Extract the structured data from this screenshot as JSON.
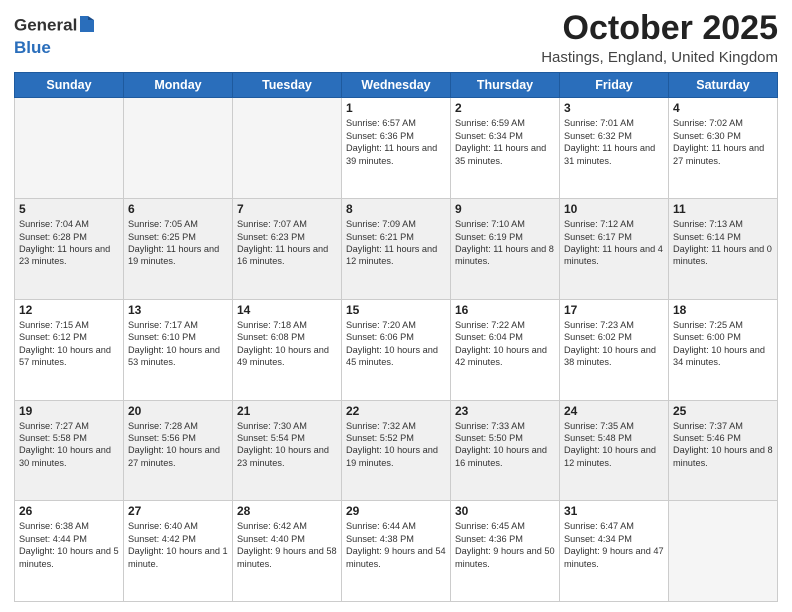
{
  "header": {
    "logo_general": "General",
    "logo_blue": "Blue",
    "title": "October 2025",
    "location": "Hastings, England, United Kingdom"
  },
  "days_of_week": [
    "Sunday",
    "Monday",
    "Tuesday",
    "Wednesday",
    "Thursday",
    "Friday",
    "Saturday"
  ],
  "weeks": [
    [
      {
        "day": "",
        "empty": true
      },
      {
        "day": "",
        "empty": true
      },
      {
        "day": "",
        "empty": true
      },
      {
        "day": "1",
        "sunrise": "6:57 AM",
        "sunset": "6:36 PM",
        "daylight": "11 hours and 39 minutes."
      },
      {
        "day": "2",
        "sunrise": "6:59 AM",
        "sunset": "6:34 PM",
        "daylight": "11 hours and 35 minutes."
      },
      {
        "day": "3",
        "sunrise": "7:01 AM",
        "sunset": "6:32 PM",
        "daylight": "11 hours and 31 minutes."
      },
      {
        "day": "4",
        "sunrise": "7:02 AM",
        "sunset": "6:30 PM",
        "daylight": "11 hours and 27 minutes."
      }
    ],
    [
      {
        "day": "5",
        "sunrise": "7:04 AM",
        "sunset": "6:28 PM",
        "daylight": "11 hours and 23 minutes."
      },
      {
        "day": "6",
        "sunrise": "7:05 AM",
        "sunset": "6:25 PM",
        "daylight": "11 hours and 19 minutes."
      },
      {
        "day": "7",
        "sunrise": "7:07 AM",
        "sunset": "6:23 PM",
        "daylight": "11 hours and 16 minutes."
      },
      {
        "day": "8",
        "sunrise": "7:09 AM",
        "sunset": "6:21 PM",
        "daylight": "11 hours and 12 minutes."
      },
      {
        "day": "9",
        "sunrise": "7:10 AM",
        "sunset": "6:19 PM",
        "daylight": "11 hours and 8 minutes."
      },
      {
        "day": "10",
        "sunrise": "7:12 AM",
        "sunset": "6:17 PM",
        "daylight": "11 hours and 4 minutes."
      },
      {
        "day": "11",
        "sunrise": "7:13 AM",
        "sunset": "6:14 PM",
        "daylight": "11 hours and 0 minutes."
      }
    ],
    [
      {
        "day": "12",
        "sunrise": "7:15 AM",
        "sunset": "6:12 PM",
        "daylight": "10 hours and 57 minutes."
      },
      {
        "day": "13",
        "sunrise": "7:17 AM",
        "sunset": "6:10 PM",
        "daylight": "10 hours and 53 minutes."
      },
      {
        "day": "14",
        "sunrise": "7:18 AM",
        "sunset": "6:08 PM",
        "daylight": "10 hours and 49 minutes."
      },
      {
        "day": "15",
        "sunrise": "7:20 AM",
        "sunset": "6:06 PM",
        "daylight": "10 hours and 45 minutes."
      },
      {
        "day": "16",
        "sunrise": "7:22 AM",
        "sunset": "6:04 PM",
        "daylight": "10 hours and 42 minutes."
      },
      {
        "day": "17",
        "sunrise": "7:23 AM",
        "sunset": "6:02 PM",
        "daylight": "10 hours and 38 minutes."
      },
      {
        "day": "18",
        "sunrise": "7:25 AM",
        "sunset": "6:00 PM",
        "daylight": "10 hours and 34 minutes."
      }
    ],
    [
      {
        "day": "19",
        "sunrise": "7:27 AM",
        "sunset": "5:58 PM",
        "daylight": "10 hours and 30 minutes."
      },
      {
        "day": "20",
        "sunrise": "7:28 AM",
        "sunset": "5:56 PM",
        "daylight": "10 hours and 27 minutes."
      },
      {
        "day": "21",
        "sunrise": "7:30 AM",
        "sunset": "5:54 PM",
        "daylight": "10 hours and 23 minutes."
      },
      {
        "day": "22",
        "sunrise": "7:32 AM",
        "sunset": "5:52 PM",
        "daylight": "10 hours and 19 minutes."
      },
      {
        "day": "23",
        "sunrise": "7:33 AM",
        "sunset": "5:50 PM",
        "daylight": "10 hours and 16 minutes."
      },
      {
        "day": "24",
        "sunrise": "7:35 AM",
        "sunset": "5:48 PM",
        "daylight": "10 hours and 12 minutes."
      },
      {
        "day": "25",
        "sunrise": "7:37 AM",
        "sunset": "5:46 PM",
        "daylight": "10 hours and 8 minutes."
      }
    ],
    [
      {
        "day": "26",
        "sunrise": "6:38 AM",
        "sunset": "4:44 PM",
        "daylight": "10 hours and 5 minutes."
      },
      {
        "day": "27",
        "sunrise": "6:40 AM",
        "sunset": "4:42 PM",
        "daylight": "10 hours and 1 minute."
      },
      {
        "day": "28",
        "sunrise": "6:42 AM",
        "sunset": "4:40 PM",
        "daylight": "9 hours and 58 minutes."
      },
      {
        "day": "29",
        "sunrise": "6:44 AM",
        "sunset": "4:38 PM",
        "daylight": "9 hours and 54 minutes."
      },
      {
        "day": "30",
        "sunrise": "6:45 AM",
        "sunset": "4:36 PM",
        "daylight": "9 hours and 50 minutes."
      },
      {
        "day": "31",
        "sunrise": "6:47 AM",
        "sunset": "4:34 PM",
        "daylight": "9 hours and 47 minutes."
      },
      {
        "day": "",
        "empty": true
      }
    ]
  ]
}
